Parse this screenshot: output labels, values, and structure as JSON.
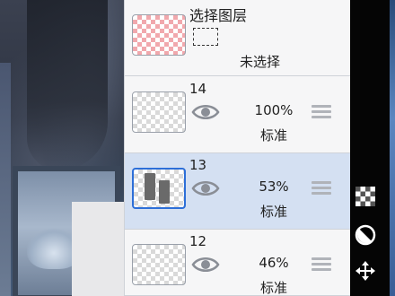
{
  "selection_layer": {
    "title": "选择图层",
    "status": "未选择"
  },
  "layers": [
    {
      "number": "14",
      "opacity": "100%",
      "blend_mode": "标准",
      "selected": false
    },
    {
      "number": "13",
      "opacity": "53%",
      "blend_mode": "标准",
      "selected": true
    },
    {
      "number": "12",
      "opacity": "46%",
      "blend_mode": "标准",
      "selected": false
    }
  ],
  "tools": [
    {
      "icon": "checkerboard-icon"
    },
    {
      "icon": "opacity-circle-icon"
    },
    {
      "icon": "move-arrows-icon"
    }
  ],
  "colors": {
    "selection_thumb": "#f1a8ad",
    "selected_row": "#d4e0f2",
    "selected_border": "#2d6fd8"
  }
}
